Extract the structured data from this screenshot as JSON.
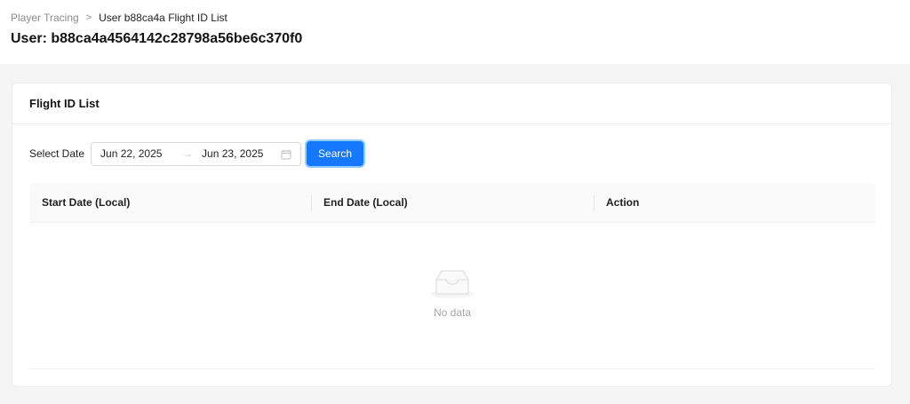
{
  "breadcrumb": {
    "parent": "Player Tracing",
    "separator": ">",
    "current": "User b88ca4a Flight ID List"
  },
  "page": {
    "title": "User: b88ca4a4564142c28798a56be6c370f0"
  },
  "card": {
    "title": "Flight ID List"
  },
  "filter": {
    "label": "Select Date",
    "start_date": "Jun 22, 2025",
    "end_date": "Jun 23, 2025",
    "range_separator": "→",
    "search_label": "Search"
  },
  "table": {
    "columns": [
      "Start Date (Local)",
      "End Date (Local)",
      "Action"
    ],
    "rows": [],
    "empty_text": "No data"
  },
  "colors": {
    "primary": "#1677ff",
    "page_bg": "#f5f5f5"
  },
  "icons": {
    "calendar": "calendar-icon",
    "empty": "empty-inbox-icon"
  }
}
